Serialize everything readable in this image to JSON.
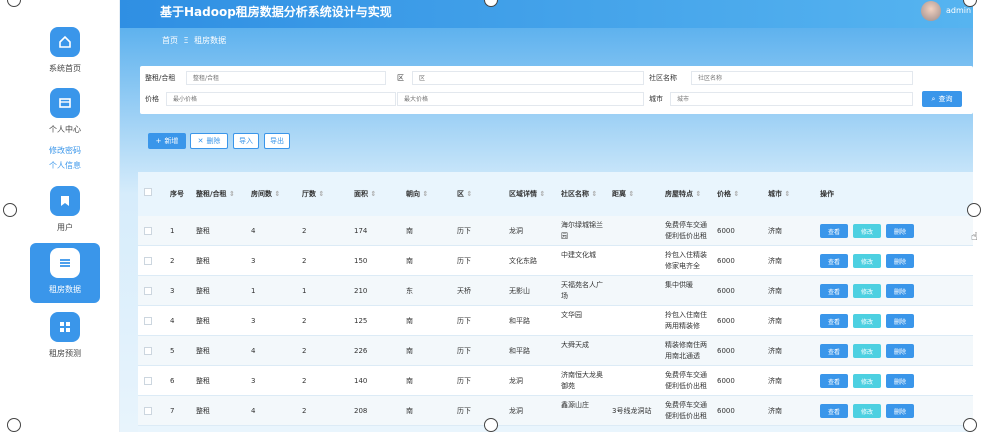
{
  "app": {
    "title": "基于Hadoop租房数据分析系统设计与实现",
    "user": "admin"
  },
  "breadcrumb": {
    "home": "首页",
    "sep": "Ξ",
    "current": "租房数据"
  },
  "sidebar": {
    "items": [
      {
        "label": "系统首页",
        "icon": "home-icon"
      },
      {
        "label": "个人中心",
        "icon": "card-icon",
        "subs": [
          "修改密码",
          "个人信息"
        ]
      },
      {
        "label": "用户",
        "icon": "bookmark-icon"
      },
      {
        "label": "租房数据",
        "icon": "list-icon"
      },
      {
        "label": "租房预测",
        "icon": "grid-icon"
      }
    ]
  },
  "search": {
    "fields": [
      {
        "label": "整租/合租",
        "placeholder": "整租/合租"
      },
      {
        "label": "区",
        "placeholder": "区"
      },
      {
        "label": "社区名称",
        "placeholder": "社区名称"
      },
      {
        "label": "价格",
        "placeholder": "最小价格"
      },
      {
        "label": "",
        "placeholder": "最大价格"
      },
      {
        "label": "城市",
        "placeholder": "城市"
      }
    ],
    "button": "查询"
  },
  "actions": {
    "add": "新增",
    "delete": "删除",
    "import": "导入",
    "export": "导出"
  },
  "table": {
    "headers": [
      "序号",
      "整租/合租",
      "房间数",
      "厅数",
      "面积",
      "朝向",
      "区",
      "区域详情",
      "社区名称",
      "距离",
      "房屋特点",
      "价格",
      "城市",
      "操作"
    ],
    "sort_marker": "⇕",
    "row_buttons": {
      "view": "查看",
      "edit": "修改",
      "delete": "删除"
    },
    "rows": [
      [
        "1",
        "整租",
        "4",
        "2",
        "174",
        "南",
        "历下",
        "龙洞",
        "海尔绿城锦兰园",
        "",
        "免费停车交通便利低价出租",
        "6000",
        "济南"
      ],
      [
        "2",
        "整租",
        "3",
        "2",
        "150",
        "南",
        "历下",
        "文化东路",
        "中建文化城",
        "",
        "拎包入住精装修家电齐全",
        "6000",
        "济南"
      ],
      [
        "3",
        "整租",
        "1",
        "1",
        "210",
        "东",
        "天桥",
        "无影山",
        "天福苑名人广场",
        "",
        "集中供暖",
        "6000",
        "济南"
      ],
      [
        "4",
        "整租",
        "3",
        "2",
        "125",
        "南",
        "历下",
        "和平路",
        "文华园",
        "",
        "拎包入住南住两用精装修",
        "6000",
        "济南"
      ],
      [
        "5",
        "整租",
        "4",
        "2",
        "226",
        "南",
        "历下",
        "和平路",
        "大舜天成",
        "",
        "精装修南住两用南北通透",
        "6000",
        "济南"
      ],
      [
        "6",
        "整租",
        "3",
        "2",
        "140",
        "南",
        "历下",
        "龙洞",
        "济南恒大龙奥御苑",
        "",
        "免费停车交通便利低价出租",
        "6000",
        "济南"
      ],
      [
        "7",
        "整租",
        "4",
        "2",
        "208",
        "南",
        "历下",
        "龙洞",
        "鑫源山庄",
        "3号线龙洞站",
        "免费停车交通便利低价出租",
        "6000",
        "济南"
      ]
    ]
  },
  "colors": {
    "primary": "#3a96ea",
    "edit": "#4dd0e1",
    "topbar": "#2f8fe3"
  }
}
